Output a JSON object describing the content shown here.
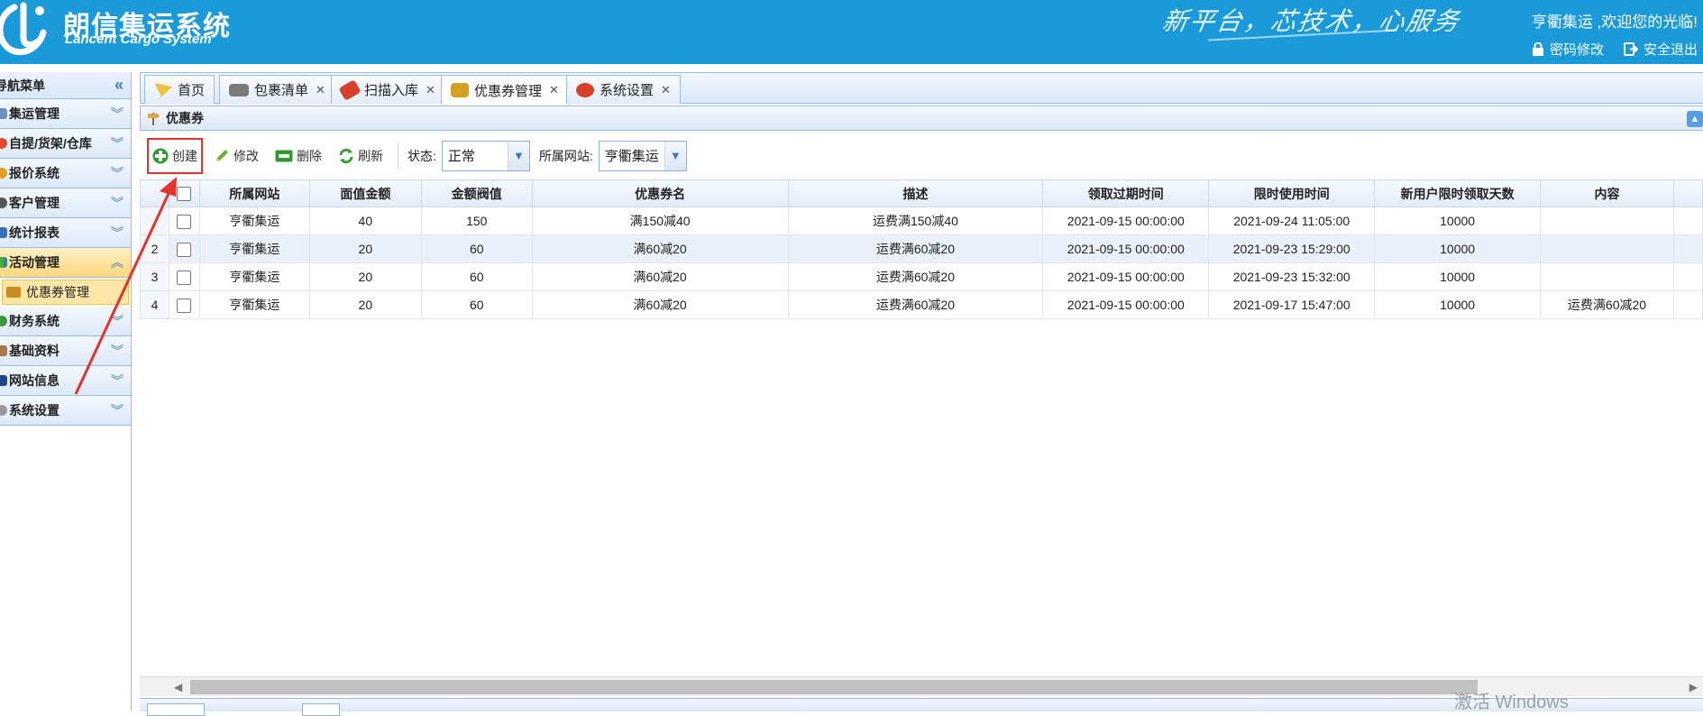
{
  "header": {
    "logo_title": "朗信集运系统",
    "logo_subtitle": "Lancent Cargo System",
    "slogan": "新平台，芯技术，心服务",
    "welcome": "亨衢集运 ,欢迎您的光临!",
    "change_password": "密码修改",
    "logout": "安全退出",
    "color": "#1a9ad9"
  },
  "sidebar": {
    "title": "导航菜单",
    "items": [
      {
        "label": "集运管理"
      },
      {
        "label": "自提/货架/仓库"
      },
      {
        "label": "报价系统"
      },
      {
        "label": "客户管理"
      },
      {
        "label": "统计报表"
      },
      {
        "label": "活动管理"
      },
      {
        "label": "财务系统"
      },
      {
        "label": "基础资料"
      },
      {
        "label": "网站信息"
      },
      {
        "label": "系统设置"
      }
    ],
    "sub_active": "优惠券管理"
  },
  "tabs": [
    {
      "label": "首页"
    },
    {
      "label": "包裹清单"
    },
    {
      "label": "扫描入库"
    },
    {
      "label": "优惠券管理"
    },
    {
      "label": "系统设置"
    }
  ],
  "panel": {
    "title": "优惠券"
  },
  "toolbar": {
    "create": "创建",
    "edit": "修改",
    "delete": "删除",
    "refresh": "刷新",
    "status_label": "状态:",
    "status_value": "正常",
    "site_label": "所属网站:",
    "site_value": "亨衢集运"
  },
  "table": {
    "columns": [
      "所属网站",
      "面值金额",
      "金额阀值",
      "优惠券名",
      "描述",
      "领取过期时间",
      "限时使用时间",
      "新用户限时领取天数",
      "内容"
    ],
    "rows": [
      {
        "rn": "",
        "cells": [
          "亨衢集运",
          "40",
          "150",
          "满150减40",
          "运费满150减40",
          "2021-09-15 00:00:00",
          "2021-09-24 11:05:00",
          "10000",
          ""
        ]
      },
      {
        "rn": "2",
        "cells": [
          "亨衢集运",
          "20",
          "60",
          "满60减20",
          "运费满60减20",
          "2021-09-15 00:00:00",
          "2021-09-23 15:29:00",
          "10000",
          ""
        ]
      },
      {
        "rn": "3",
        "cells": [
          "亨衢集运",
          "20",
          "60",
          "满60减20",
          "运费满60减20",
          "2021-09-15 00:00:00",
          "2021-09-23 15:32:00",
          "10000",
          ""
        ]
      },
      {
        "rn": "4",
        "cells": [
          "亨衢集运",
          "20",
          "60",
          "满60减20",
          "运费满60减20",
          "2021-09-15 00:00:00",
          "2021-09-17 15:47:00",
          "10000",
          "运费满60减20"
        ]
      }
    ]
  },
  "watermark": "激活 Windows"
}
